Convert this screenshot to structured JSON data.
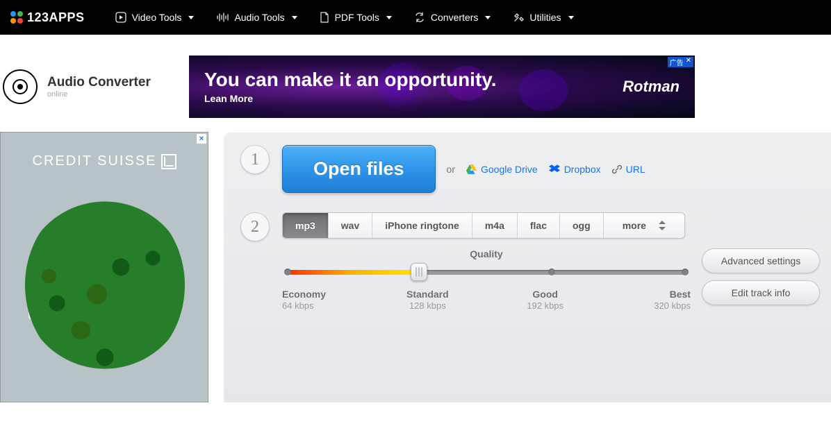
{
  "nav": {
    "brand": "123APPS",
    "items": [
      {
        "label": "Video Tools"
      },
      {
        "label": "Audio Tools"
      },
      {
        "label": "PDF Tools"
      },
      {
        "label": "Converters"
      },
      {
        "label": "Utilities"
      }
    ]
  },
  "app": {
    "title": "Audio Converter",
    "subtitle": "online"
  },
  "banner_ad": {
    "headline": "You can make it an opportunity.",
    "cta": "Lean More",
    "brand": "Rotman",
    "tag": "广告",
    "close": "✕"
  },
  "side_ad": {
    "brand": "CREDIT SUISSE",
    "close": "✕"
  },
  "step1": {
    "num": "1",
    "open": "Open files",
    "or": "or",
    "gdrive": "Google Drive",
    "dropbox": "Dropbox",
    "url": "URL"
  },
  "step2": {
    "num": "2",
    "formats": [
      "mp3",
      "wav",
      "iPhone ringtone",
      "m4a",
      "flac",
      "ogg",
      "more"
    ],
    "active_index": 0,
    "quality": {
      "title": "Quality",
      "position_pct": 33,
      "labels": [
        {
          "name": "Economy",
          "kbps": "64 kbps"
        },
        {
          "name": "Standard",
          "kbps": "128 kbps"
        },
        {
          "name": "Good",
          "kbps": "192 kbps"
        },
        {
          "name": "Best",
          "kbps": "320 kbps"
        }
      ]
    },
    "advanced": "Advanced settings",
    "edit_track": "Edit track info"
  }
}
